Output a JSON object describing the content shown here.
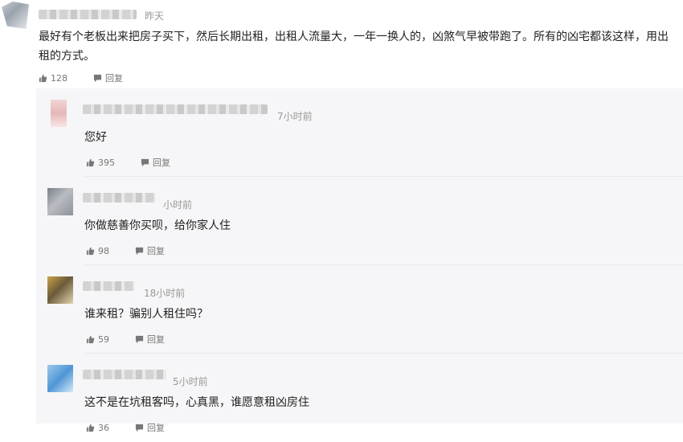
{
  "top_comment": {
    "time": "昨天",
    "text": "最好有个老板出来把房子买下，然后长期出租，出租人流量大，一年一换人的，凶煞气早被带跑了。所有的凶宅都该这样，用出租的方式。",
    "likes": "128",
    "reply_label": "回复"
  },
  "replies": [
    {
      "time": "7小时前",
      "text": "您好",
      "likes": "395",
      "reply_label": "回复"
    },
    {
      "time": "小时前",
      "text": "你做慈善你买呗，给你家人住",
      "likes": "98",
      "reply_label": "回复"
    },
    {
      "time": "18小时前",
      "text": "谁来租？骗别人租住吗？",
      "likes": "59",
      "reply_label": "回复"
    },
    {
      "time": "5小时前",
      "text": "这不是在坑租客吗，心真黑，谁愿意租凶房住",
      "likes": "36",
      "reply_label": "回复"
    }
  ],
  "icons": {
    "like": "thumbs-up-icon",
    "reply": "comment-icon"
  }
}
